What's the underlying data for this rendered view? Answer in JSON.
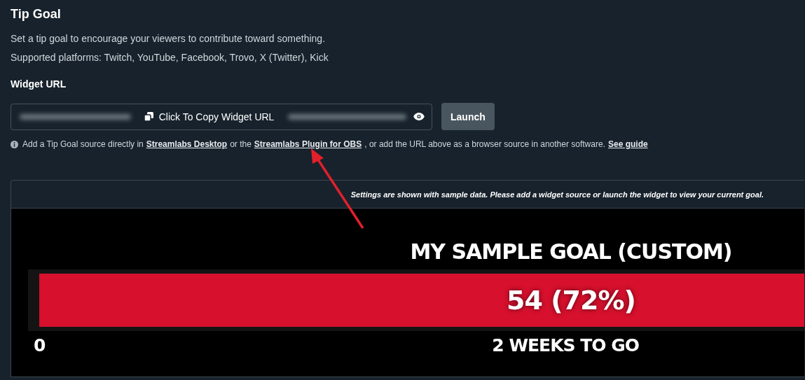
{
  "title": "Tip Goal",
  "description": [
    "Set a tip goal to encourage your viewers to contribute toward something.",
    "Supported platforms: Twitch, YouTube, Facebook, Trovo, X (Twitter), Kick"
  ],
  "widget_url": {
    "label": "Widget URL",
    "copy_label": "Click To Copy Widget URL",
    "launch": "Launch"
  },
  "note": [
    {
      "kind": "text",
      "text": "Add a Tip Goal source directly in"
    },
    {
      "kind": "link",
      "text": "Streamlabs Desktop"
    },
    {
      "kind": "text",
      "text": "or the"
    },
    {
      "kind": "link",
      "text": "Streamlabs Plugin for OBS"
    },
    {
      "kind": "text",
      "text": ", or add the URL above as a browser source in another software."
    },
    {
      "kind": "link",
      "text": "See guide"
    }
  ],
  "preview": {
    "notice": "Settings are shown with sample data. Please add a widget source or launch the widget to view your current goal.",
    "goal_title": "MY SAMPLE GOAL (CUSTOM)",
    "amount": "54 (72%)",
    "level": 1,
    "start": "0",
    "time_left": "2 WEEKS TO GO"
  }
}
